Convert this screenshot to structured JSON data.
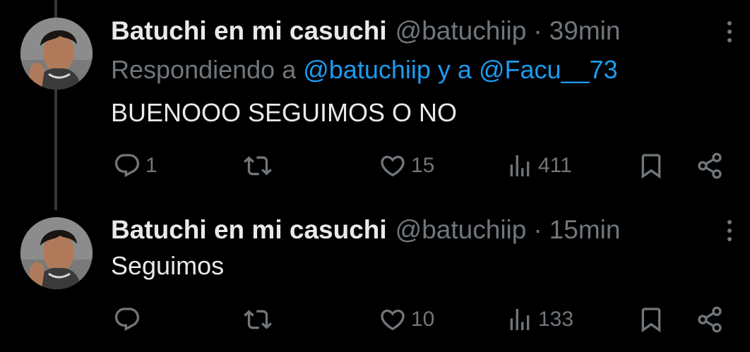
{
  "tweets": [
    {
      "display_name": "Batuchi en mi casuchi",
      "handle": "@batuchiip",
      "separator": "·",
      "time": "39min",
      "replying_prefix": "Respondiendo a",
      "replying_user1": "@batuchiip",
      "replying_joiner": "y a",
      "replying_user2": "@Facu__73",
      "text": "BUENOOO SEGUIMOS O NO",
      "replies": "1",
      "retweets": "",
      "likes": "15",
      "views": "411"
    },
    {
      "display_name": "Batuchi en mi casuchi",
      "handle": "@batuchiip",
      "separator": "·",
      "time": "15min",
      "text": "Seguimos",
      "replies": "",
      "retweets": "",
      "likes": "10",
      "views": "133"
    }
  ],
  "icons": {
    "reply": "reply-icon",
    "retweet": "retweet-icon",
    "like": "heart-icon",
    "views": "views-chart-icon",
    "bookmark": "bookmark-icon",
    "share": "share-icon",
    "more": "more-vertical-icon"
  },
  "colors": {
    "background": "#000000",
    "text_primary": "#e7e9ea",
    "text_secondary": "#71767b",
    "link": "#1d9bf0",
    "thread_line": "#333639"
  }
}
